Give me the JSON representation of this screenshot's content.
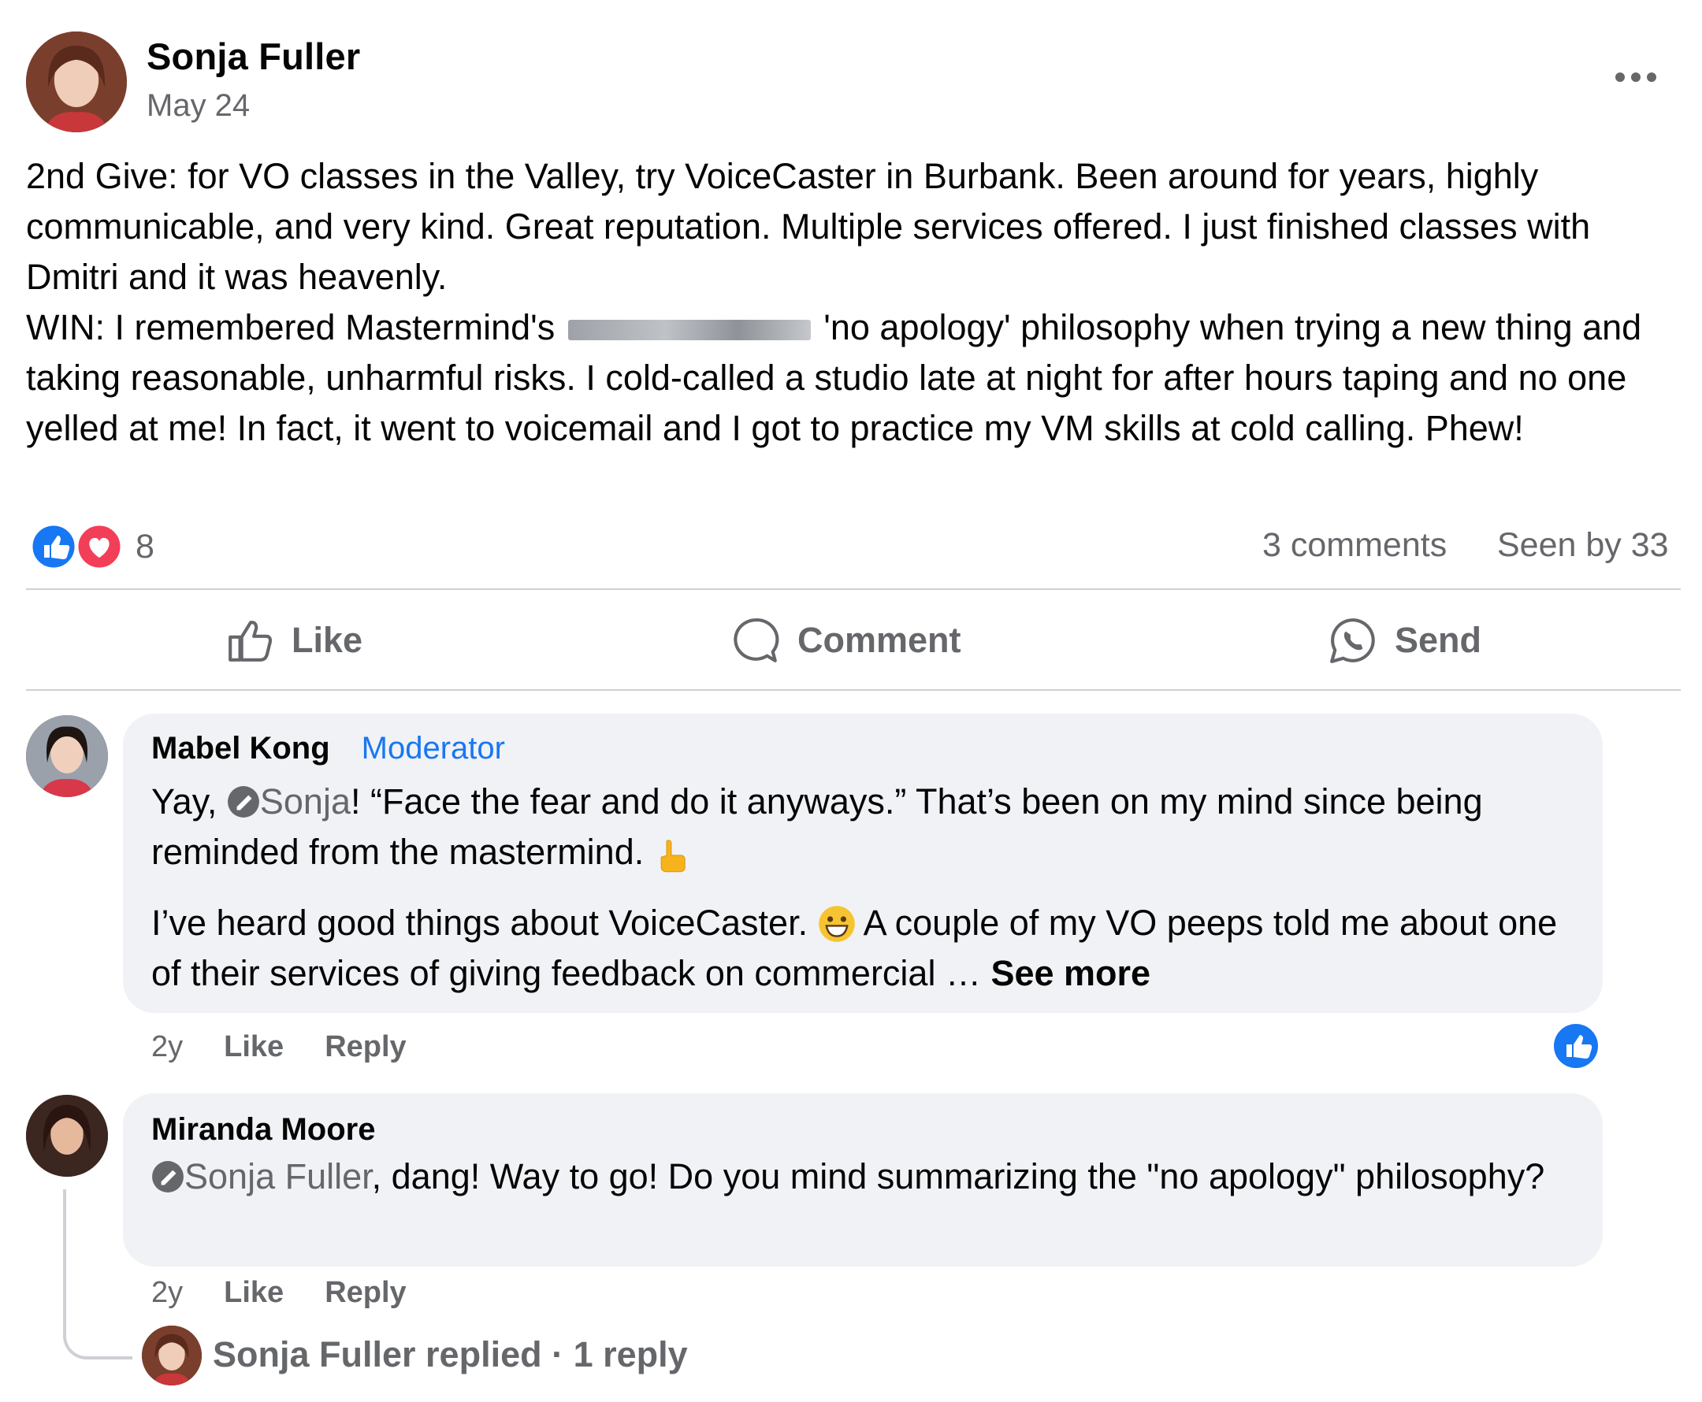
{
  "post": {
    "author": "Sonja Fuller",
    "date": "May 24",
    "text_before_redaction": "2nd Give: for VO classes in the Valley, try VoiceCaster in Burbank. Been around for years, highly communicable, and very kind. Great reputation. Multiple services offered. I just finished classes with Dmitri and it was heavenly.\nWIN: I remembered Mastermind's",
    "text_after_redaction": "'no apology' philosophy when trying a new thing and taking reasonable, unharmful risks. I cold-called a studio late at night for after hours taping and no one yelled at me! In fact, it went to voicemail and I got to practice my VM skills at cold calling. Phew!",
    "reaction_count": "8",
    "comments_count": "3 comments",
    "seen_by": "Seen by 33",
    "actions": {
      "like": "Like",
      "comment": "Comment",
      "send": "Send"
    },
    "colors": {
      "like_blue": "#1877f2",
      "love_red": "#f33e58"
    }
  },
  "comments": [
    {
      "author": "Mabel Kong",
      "badge": "Moderator",
      "para1_prefix": "Yay,",
      "para1_mention": "Sonja",
      "para1_rest": "! “Face the fear and do it anyways.” That’s been on my mind since being reminded from the mastermind.",
      "para2_text": "I’ve heard good things about VoiceCaster.",
      "para2_rest": "A couple of my VO peeps told me about one of their services of giving feedback on commercial …",
      "see_more": "See more",
      "time": "2y",
      "like": "Like",
      "reply": "Reply"
    },
    {
      "author": "Miranda Moore",
      "mention": "Sonja Fuller",
      "text": ", dang! Way to go! Do you mind summarizing the \"no apology\" philosophy?",
      "time": "2y",
      "like": "Like",
      "reply": "Reply"
    }
  ],
  "reply_summary": "Sonja Fuller replied · 1 reply"
}
